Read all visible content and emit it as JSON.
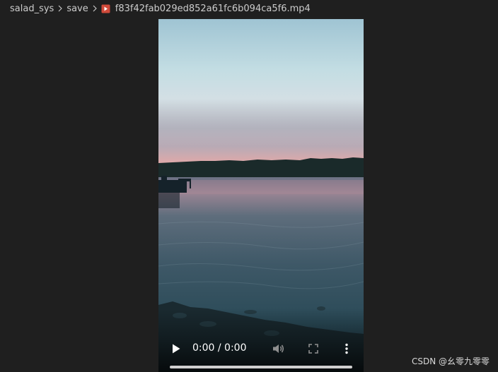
{
  "breadcrumb": {
    "items": [
      "salad_sys",
      "save"
    ],
    "file_name": "f83f42fab029ed852a61fc6b094ca5f6.mp4",
    "file_icon": "video-file-icon"
  },
  "video": {
    "current_time": "0:00 / 0:00",
    "progress": 0,
    "icons": {
      "play": "play-icon",
      "volume": "volume-icon",
      "fullscreen": "fullscreen-icon",
      "menu": "more-vertical-icon"
    }
  },
  "watermark": {
    "text": "CSDN @幺零九零零"
  },
  "colors": {
    "background": "#1f1f1f",
    "text": "#cccccc",
    "file_icon": "#e05a47"
  }
}
